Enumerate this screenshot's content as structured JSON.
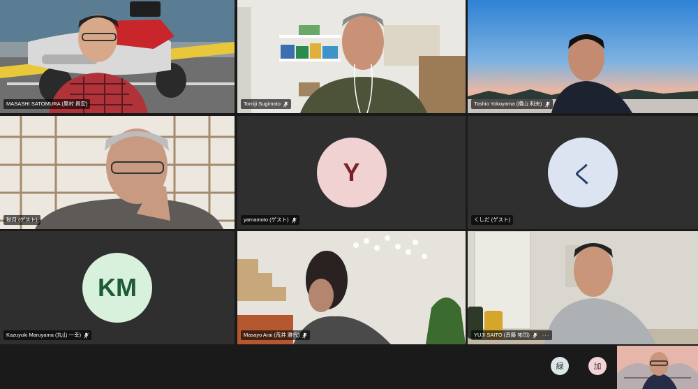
{
  "participants": [
    {
      "name": "MASASHI SATOMURA (里村 昌宏)",
      "muted": false
    },
    {
      "name": "Tomiji Sugimoto",
      "muted": true
    },
    {
      "name": "Toshio Yokoyama (横山 利夫)",
      "muted": true
    },
    {
      "name": "秋月 (ゲスト)",
      "muted": false
    },
    {
      "name": "yamamoto (ゲスト)",
      "muted": true,
      "avatar_initials": "Y",
      "avatar_bg": "#f1d2d2",
      "avatar_fg": "#7a1f2a"
    },
    {
      "name": "くしだ (ゲスト)",
      "muted": false,
      "avatar_initials": "く",
      "avatar_bg": "#dce4f2",
      "avatar_fg": "#243a66"
    },
    {
      "name": "Kazuyuki Maruyama (丸山 一幸)",
      "muted": true,
      "avatar_initials": "KM",
      "avatar_bg": "#d7f1dd",
      "avatar_fg": "#1e5a33"
    },
    {
      "name": "Masayo Arai (荒井 雅代)",
      "muted": true
    },
    {
      "name": "YUJI SAITO (斉藤 祐司)",
      "muted": true,
      "more": "···"
    }
  ],
  "bottom": {
    "reaction_1": "緑",
    "reaction_2": "加"
  },
  "colors": {
    "background": "#1a1a1a",
    "tile_empty": "#2f2f2f"
  }
}
